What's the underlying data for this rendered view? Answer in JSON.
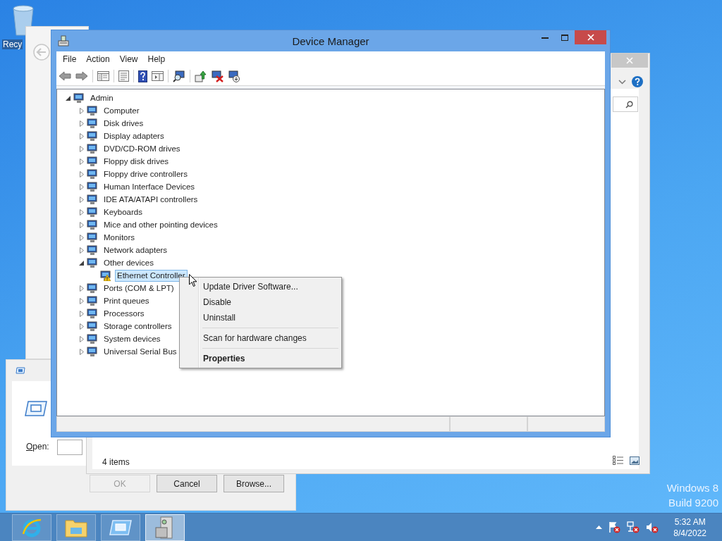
{
  "desktop": {
    "icon_label": "Recy",
    "os_version": [
      "Windows 8",
      "Build 9200"
    ]
  },
  "explorer": {
    "status": "4 items"
  },
  "run_dialog": {
    "open_label": "Open:",
    "buttons": [
      {
        "label": "OK",
        "disabled": true
      },
      {
        "label": "Cancel",
        "disabled": false
      },
      {
        "label": "Browse...",
        "disabled": false
      }
    ]
  },
  "device_manager": {
    "title": "Device Manager",
    "menu": [
      "File",
      "Action",
      "View",
      "Help"
    ],
    "tree": {
      "label": "Admin",
      "expanded": true,
      "selected": false,
      "warning": false,
      "children": [
        {
          "label": "Computer",
          "expanded": false,
          "selected": false,
          "warning": false
        },
        {
          "label": "Disk drives",
          "expanded": false,
          "selected": false,
          "warning": false
        },
        {
          "label": "Display adapters",
          "expanded": false,
          "selected": false,
          "warning": false
        },
        {
          "label": "DVD/CD-ROM drives",
          "expanded": false,
          "selected": false,
          "warning": false
        },
        {
          "label": "Floppy disk drives",
          "expanded": false,
          "selected": false,
          "warning": false
        },
        {
          "label": "Floppy drive controllers",
          "expanded": false,
          "selected": false,
          "warning": false
        },
        {
          "label": "Human Interface Devices",
          "expanded": false,
          "selected": false,
          "warning": false
        },
        {
          "label": "IDE ATA/ATAPI controllers",
          "expanded": false,
          "selected": false,
          "warning": false
        },
        {
          "label": "Keyboards",
          "expanded": false,
          "selected": false,
          "warning": false
        },
        {
          "label": "Mice and other pointing devices",
          "expanded": false,
          "selected": false,
          "warning": false
        },
        {
          "label": "Monitors",
          "expanded": false,
          "selected": false,
          "warning": false
        },
        {
          "label": "Network adapters",
          "expanded": false,
          "selected": false,
          "warning": false
        },
        {
          "label": "Other devices",
          "expanded": true,
          "selected": false,
          "warning": false,
          "children": [
            {
              "label": "Ethernet Controller",
              "selected": true,
              "warning": true
            }
          ]
        },
        {
          "label": "Ports (COM & LPT)",
          "expanded": false,
          "selected": false,
          "warning": false
        },
        {
          "label": "Print queues",
          "expanded": false,
          "selected": false,
          "warning": false
        },
        {
          "label": "Processors",
          "expanded": false,
          "selected": false,
          "warning": false
        },
        {
          "label": "Storage controllers",
          "expanded": false,
          "selected": false,
          "warning": false
        },
        {
          "label": "System devices",
          "expanded": false,
          "selected": false,
          "warning": false
        },
        {
          "label": "Universal Serial Bus",
          "expanded": false,
          "selected": false,
          "warning": false
        }
      ]
    }
  },
  "context_menu": [
    {
      "kind": "item",
      "label": "Update Driver Software...",
      "default": false
    },
    {
      "kind": "item",
      "label": "Disable",
      "default": false
    },
    {
      "kind": "item",
      "label": "Uninstall",
      "default": false
    },
    {
      "kind": "separator"
    },
    {
      "kind": "item",
      "label": "Scan for hardware changes",
      "default": false
    },
    {
      "kind": "separator"
    },
    {
      "kind": "item",
      "label": "Properties",
      "default": true
    }
  ],
  "taskbar": {
    "buttons": [
      {
        "kind": "browser",
        "selected": false
      },
      {
        "kind": "folder",
        "selected": false
      },
      {
        "kind": "run",
        "selected": false
      },
      {
        "kind": "device-manager",
        "selected": true
      }
    ],
    "time": "5:32 AM",
    "date": "8/4/2022"
  }
}
